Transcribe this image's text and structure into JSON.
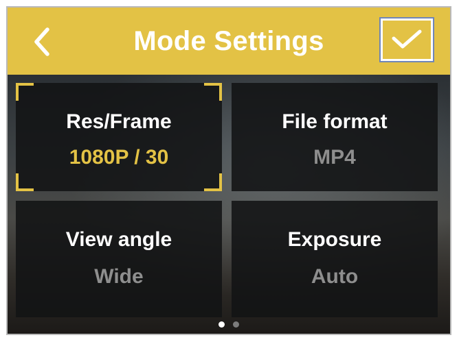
{
  "header": {
    "title": "Mode Settings",
    "back_icon": "chevron-left-icon",
    "confirm_icon": "checkmark-icon",
    "accent_color": "#e3c245"
  },
  "tiles": [
    {
      "label": "Res/Frame",
      "value": "1080P / 30",
      "selected": true
    },
    {
      "label": "File format",
      "value": "MP4",
      "selected": false
    },
    {
      "label": "View angle",
      "value": "Wide",
      "selected": false
    },
    {
      "label": "Exposure",
      "value": "Auto",
      "selected": false
    }
  ],
  "pagination": {
    "pages": 2,
    "current": 1
  }
}
